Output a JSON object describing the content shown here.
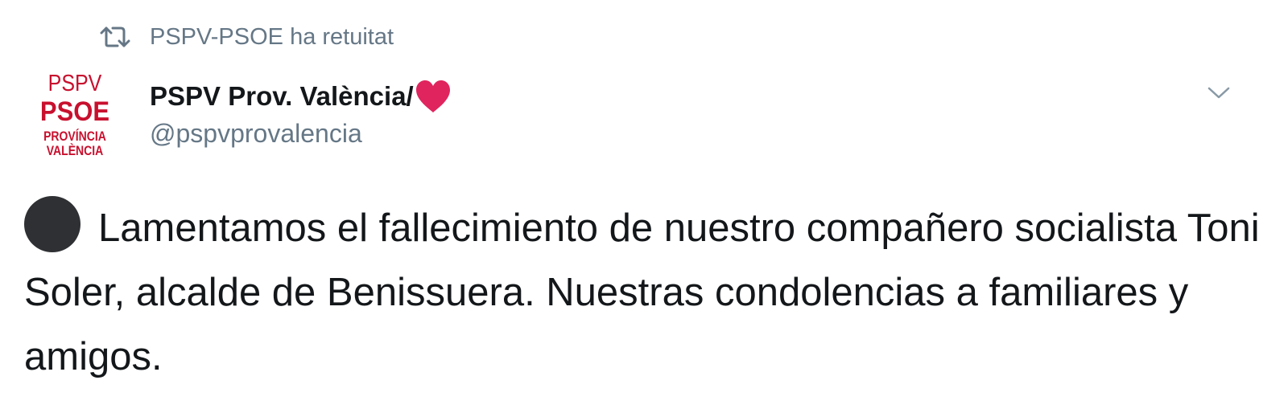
{
  "retweet_context": {
    "icon": "retweet-icon",
    "text": "PSPV-PSOE ha retuitat"
  },
  "author": {
    "avatar": {
      "line1": "PSPV",
      "line2": "PSOE",
      "line3": "PROVÍNCIA",
      "line4": "VALÈNCIA",
      "color": "#c8102e"
    },
    "display_name": "PSPV Prov. València/",
    "name_emoji": "red-heart-icon",
    "handle": "@pspvprovalencia"
  },
  "menu": {
    "icon": "chevron-down-icon"
  },
  "tweet": {
    "emoji": "black-circle-icon",
    "text": "Lamentamos el fallecimiento de nuestro compañero socialista Toni Soler, alcalde de Benissuera. Nuestras condolencias a familiares y amigos."
  },
  "colors": {
    "text": "#14171a",
    "secondary": "#657786",
    "brand_red": "#c8102e",
    "heart": "#e0245e"
  }
}
